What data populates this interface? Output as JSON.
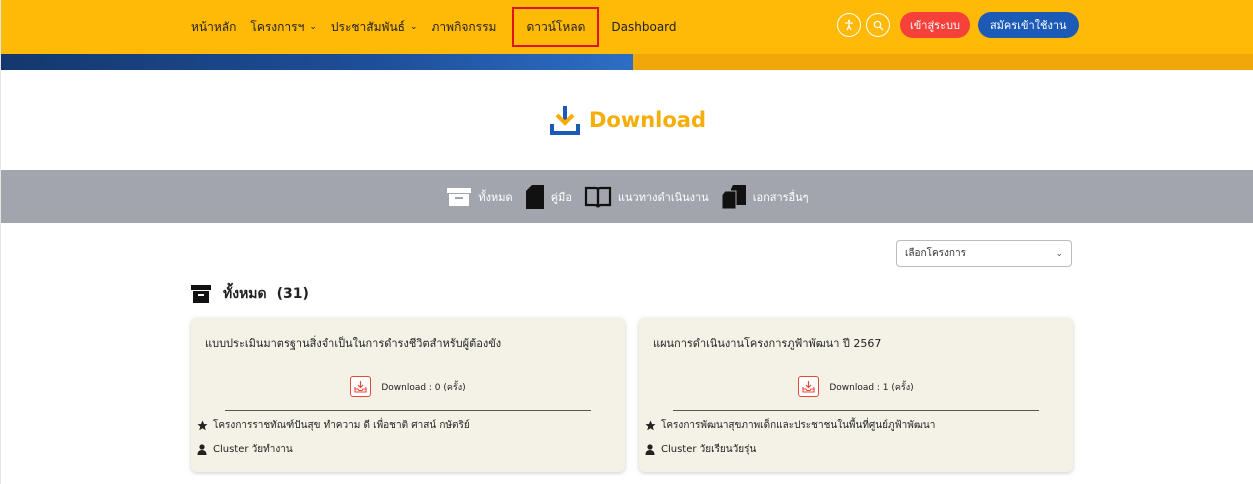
{
  "nav": {
    "items": [
      {
        "label": "หน้าหลัก"
      },
      {
        "label": "โครงการฯ"
      },
      {
        "label": "ประชาสัมพันธ์"
      },
      {
        "label": "ภาพกิจกรรม"
      },
      {
        "label": "ดาวน์โหลด"
      },
      {
        "label": "Dashboard"
      }
    ],
    "login_label": "เข้าสู่ระบบ",
    "register_label": "สมัครเข้าใช้งาน"
  },
  "hero": {
    "title": "Download"
  },
  "categories": [
    {
      "label": "ทั้งหมด"
    },
    {
      "label": "คู่มือ"
    },
    {
      "label": "แนวทางดำเนินงาน"
    },
    {
      "label": "เอกสารอื่นๆ"
    }
  ],
  "filter": {
    "selected": "เลือกโครงการ"
  },
  "section": {
    "label": "ทั้งหมด",
    "count": "(31)"
  },
  "cards": [
    {
      "title": "แบบประเมินมาตรฐานสิ่งจำเป็นในการดำรงชีวิตสำหรับผู้ต้องขัง",
      "download": "Download : 0 (ครั้ง)",
      "project": "โครงการราชทัณฑ์ปันสุข ทำความ ดี เพื่อชาติ ศาสน์ กษัตริย์",
      "cluster": "Cluster วัยทำงาน"
    },
    {
      "title": "แผนการดำเนินงานโครงการภูฟ้าพัฒนา ปี 2567",
      "download": "Download : 1 (ครั้ง)",
      "project": "โครงการพัฒนาสุขภาพเด็กและประชาชนในพื้นที่ศูนย์ภูฟ้าพัฒนา",
      "cluster": "Cluster วัยเรียนวัยรุ่น"
    }
  ],
  "colors": {
    "accent": "#ffba08",
    "brand_blue": "#1b5bb7",
    "login_red": "#f5413a",
    "title_gold": "#f6ad08"
  }
}
